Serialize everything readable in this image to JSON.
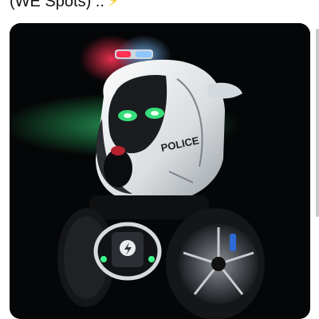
{
  "post": {
    "caption_text": "(WE Spots) ..",
    "caption_emoji": "⚡"
  },
  "media": {
    "vehicle_label": "POLICE",
    "icon": "police-robot-vehicle-image",
    "colors": {
      "background": "#050607",
      "shell": "#e9ecee",
      "headlight_green": "#3dff8c",
      "siren_red": "#ff2a4a",
      "siren_blue": "#5aa8ff",
      "tire": "#151618"
    }
  }
}
